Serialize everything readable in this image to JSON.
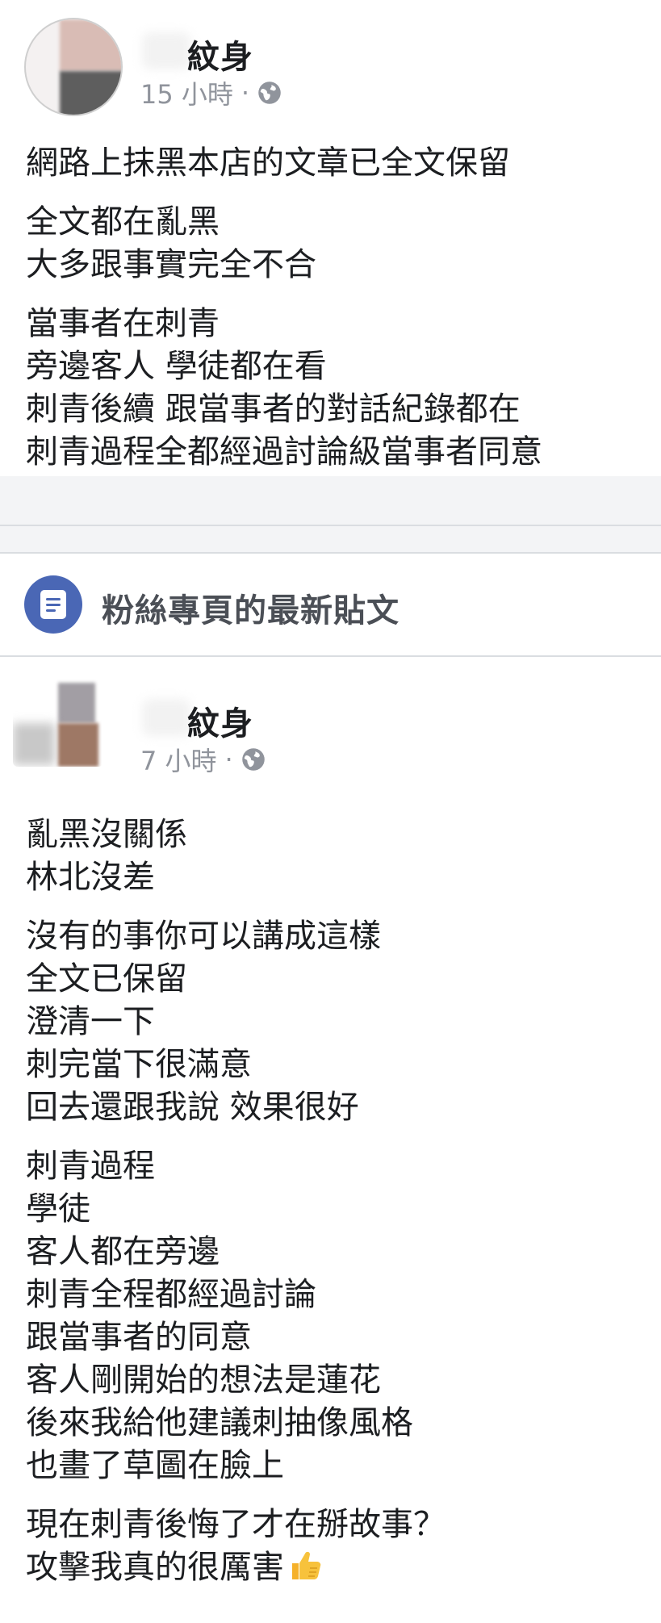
{
  "post1": {
    "author_visible": "紋身",
    "time": "15 小時",
    "dot": "·",
    "privacy_icon": "globe-icon",
    "paragraphs": [
      [
        "網路上抹黑本店的文章已全文保留"
      ],
      [
        "全文都在亂黑",
        "大多跟事實完全不合"
      ],
      [
        "當事者在刺青",
        "旁邊客人 學徒都在看",
        "刺青後續 跟當事者的對話紀錄都在",
        "刺青過程全都經過討論級當事者同意"
      ]
    ]
  },
  "section": {
    "icon": "document-icon",
    "label": "粉絲專頁的最新貼文"
  },
  "post2": {
    "author_visible": "紋身",
    "time": "7 小時",
    "dot": "·",
    "privacy_icon": "globe-icon",
    "paragraphs": [
      [
        "亂黑沒關係",
        "林北沒差"
      ],
      [
        "沒有的事你可以講成這樣",
        "全文已保留",
        "澄清一下",
        "刺完當下很滿意",
        "回去還跟我說 效果很好"
      ],
      [
        "刺青過程",
        "學徒",
        "客人都在旁邊",
        "刺青全程都經過討論",
        "跟當事者的同意",
        "客人剛開始的想法是蓮花",
        "後來我給他建議刺抽像風格",
        "也畫了草圖在臉上"
      ],
      [
        "現在刺青後悔了才在掰故事？",
        "攻擊我真的很厲害"
      ]
    ],
    "end_emoji": "thumbs-up-icon"
  },
  "colors": {
    "text": "#1c1e21",
    "meta": "#90949c",
    "divider": "#dadde1",
    "separator_bg": "#f3f4f6",
    "icon_bg": "#4a67b5"
  }
}
